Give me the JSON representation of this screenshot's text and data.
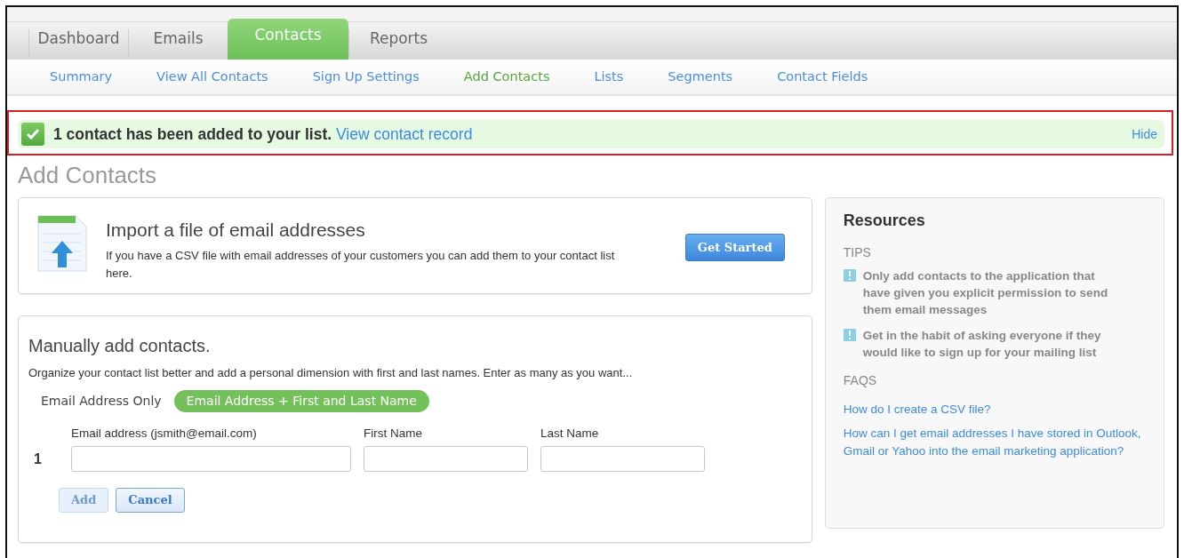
{
  "tabs": [
    {
      "label": "Dashboard",
      "selected": false
    },
    {
      "label": "Emails",
      "selected": false
    },
    {
      "label": "Contacts",
      "selected": true
    },
    {
      "label": "Reports",
      "selected": false
    }
  ],
  "subnav": [
    {
      "label": "Summary",
      "selected": false
    },
    {
      "label": "View All Contacts",
      "selected": false
    },
    {
      "label": "Sign Up Settings",
      "selected": false
    },
    {
      "label": "Add Contacts",
      "selected": true
    },
    {
      "label": "Lists",
      "selected": false
    },
    {
      "label": "Segments",
      "selected": false
    },
    {
      "label": "Contact Fields",
      "selected": false
    }
  ],
  "alert": {
    "message": "1 contact has been added to your list.",
    "link": "View contact record",
    "hide": "Hide"
  },
  "page_title": "Add Contacts",
  "import": {
    "title": "Import a file of email addresses",
    "description": "If you have a CSV file with email addresses of your customers you can add them to your contact list here.",
    "button": "Get Started"
  },
  "manual": {
    "title": "Manually add contacts.",
    "description": "Organize your contact list better and add a personal dimension with first and last names. Enter as many as you want...",
    "modes": [
      {
        "label": "Email Address Only",
        "selected": false
      },
      {
        "label": "Email Address + First and Last Name",
        "selected": true
      }
    ],
    "columns": [
      "Email address (jsmith@email.com)",
      "First Name",
      "Last Name"
    ],
    "rows": [
      {
        "number": "1"
      }
    ],
    "buttons": [
      {
        "label": "Add",
        "disabled": true
      },
      {
        "label": "Cancel",
        "disabled": false
      }
    ]
  },
  "resources": {
    "title": "Resources",
    "tips_heading": "TIPS",
    "tips": [
      "Only add contacts to the application that have given you explicit permission to send them email messages",
      "Get in the habit of asking everyone if they would like to sign up for your mailing list"
    ],
    "faqs_heading": "FAQS",
    "faqs": [
      "How do I create a CSV file?",
      "How can I get email addresses I have stored in Outlook, Gmail or Yahoo into the email marketing application?"
    ]
  }
}
